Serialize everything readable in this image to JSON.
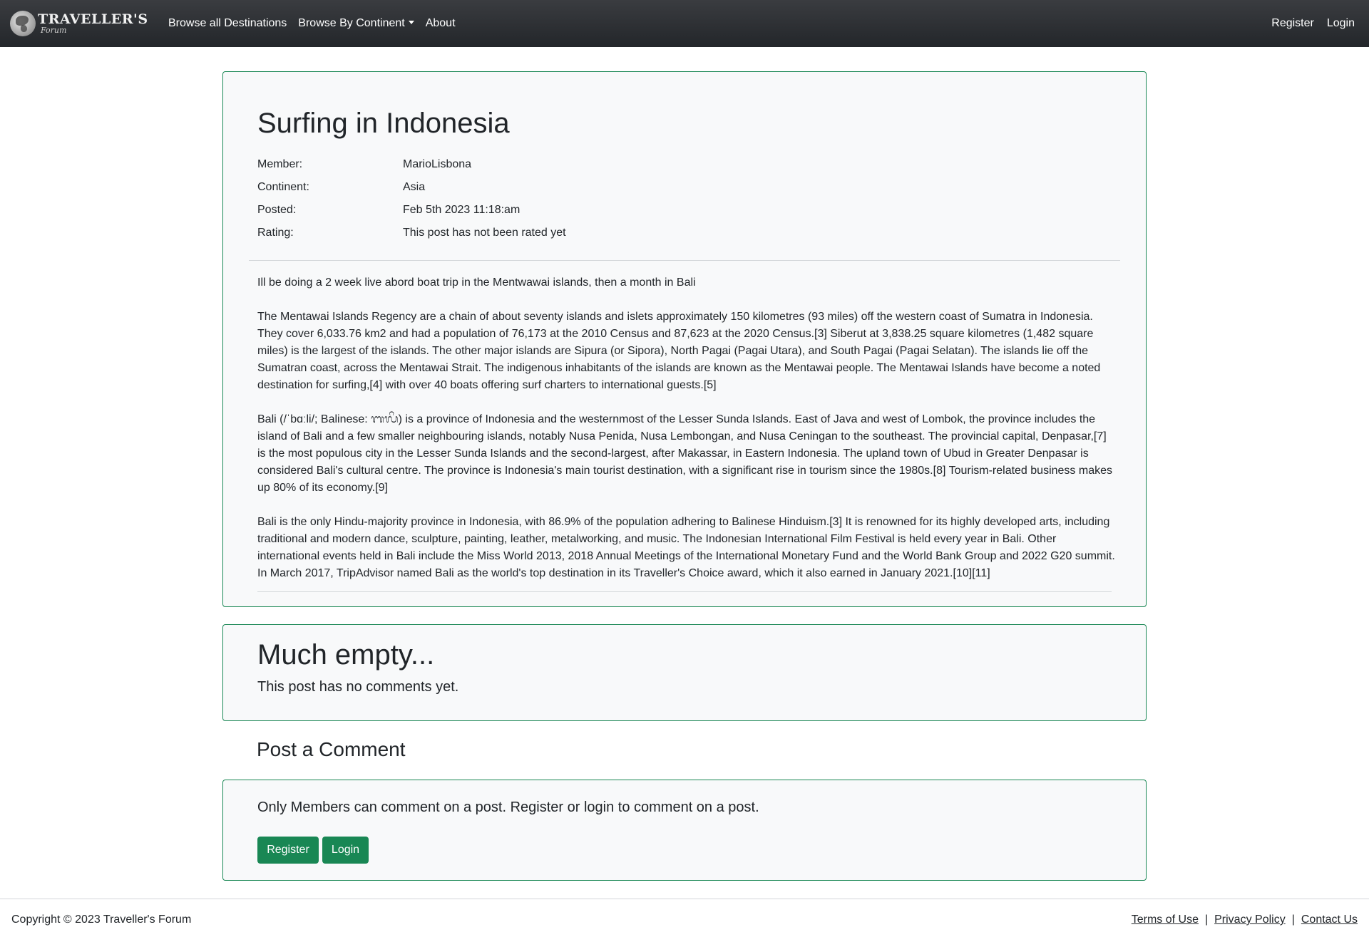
{
  "nav": {
    "brand_title": "TRAVELLER'S",
    "brand_sub": "Forum",
    "links": [
      "Browse all Destinations",
      "Browse By Continent",
      "About"
    ],
    "right_links": [
      "Register",
      "Login"
    ]
  },
  "post": {
    "title": "Surfing in Indonesia",
    "meta": [
      {
        "label": "Member:",
        "value": "MarioLisbona"
      },
      {
        "label": "Continent:",
        "value": "Asia"
      },
      {
        "label": "Posted:",
        "value": "Feb 5th 2023 11:18:am"
      },
      {
        "label": "Rating:",
        "value": "This post has not been rated yet"
      }
    ],
    "paragraphs": [
      "Ill be doing a 2 week live abord boat trip in the Mentwawai islands, then a month in Bali",
      "The Mentawai Islands Regency are a chain of about seventy islands and islets approximately 150 kilometres (93 miles) off the western coast of Sumatra in Indonesia. They cover 6,033.76 km2 and had a population of 76,173 at the 2010 Census and 87,623 at the 2020 Census.[3] Siberut at 3,838.25 square kilometres (1,482 square miles) is the largest of the islands. The other major islands are Sipura (or Sipora), North Pagai (Pagai Utara), and South Pagai (Pagai Selatan). The islands lie off the Sumatran coast, across the Mentawai Strait. The indigenous inhabitants of the islands are known as the Mentawai people. The Mentawai Islands have become a noted destination for surfing,[4] with over 40 boats offering surf charters to international guests.[5]",
      "Bali (/ˈbɑːli/; Balinese: ᬩᬮᬶ) is a province of Indonesia and the westernmost of the Lesser Sunda Islands. East of Java and west of Lombok, the province includes the island of Bali and a few smaller neighbouring islands, notably Nusa Penida, Nusa Lembongan, and Nusa Ceningan to the southeast. The provincial capital, Denpasar,[7] is the most populous city in the Lesser Sunda Islands and the second-largest, after Makassar, in Eastern Indonesia. The upland town of Ubud in Greater Denpasar is considered Bali's cultural centre. The province is Indonesia's main tourist destination, with a significant rise in tourism since the 1980s.[8] Tourism-related business makes up 80% of its economy.[9]",
      "Bali is the only Hindu-majority province in Indonesia, with 86.9% of the population adhering to Balinese Hinduism.[3] It is renowned for its highly developed arts, including traditional and modern dance, sculpture, painting, leather, metalworking, and music. The Indonesian International Film Festival is held every year in Bali. Other international events held in Bali include the Miss World 2013, 2018 Annual Meetings of the International Monetary Fund and the World Bank Group and 2022 G20 summit. In March 2017, TripAdvisor named Bali as the world's top destination in its Traveller's Choice award, which it also earned in January 2021.[10][11]"
    ]
  },
  "comments": {
    "empty_title": "Much empty...",
    "empty_text": "This post has no comments yet."
  },
  "post_comment": {
    "heading": "Post a Comment",
    "members_only_text": "Only Members can comment on a post. Register or login to comment on a post.",
    "register_label": "Register",
    "login_label": "Login"
  },
  "footer": {
    "copyright": "Copyright © 2023 Traveller's Forum",
    "links": [
      "Terms of Use",
      "Privacy Policy",
      "Contact Us"
    ],
    "separator": "|"
  },
  "colors": {
    "accent": "#198754",
    "navbar": "#2b2e32",
    "card_bg": "#f8f9fa"
  }
}
